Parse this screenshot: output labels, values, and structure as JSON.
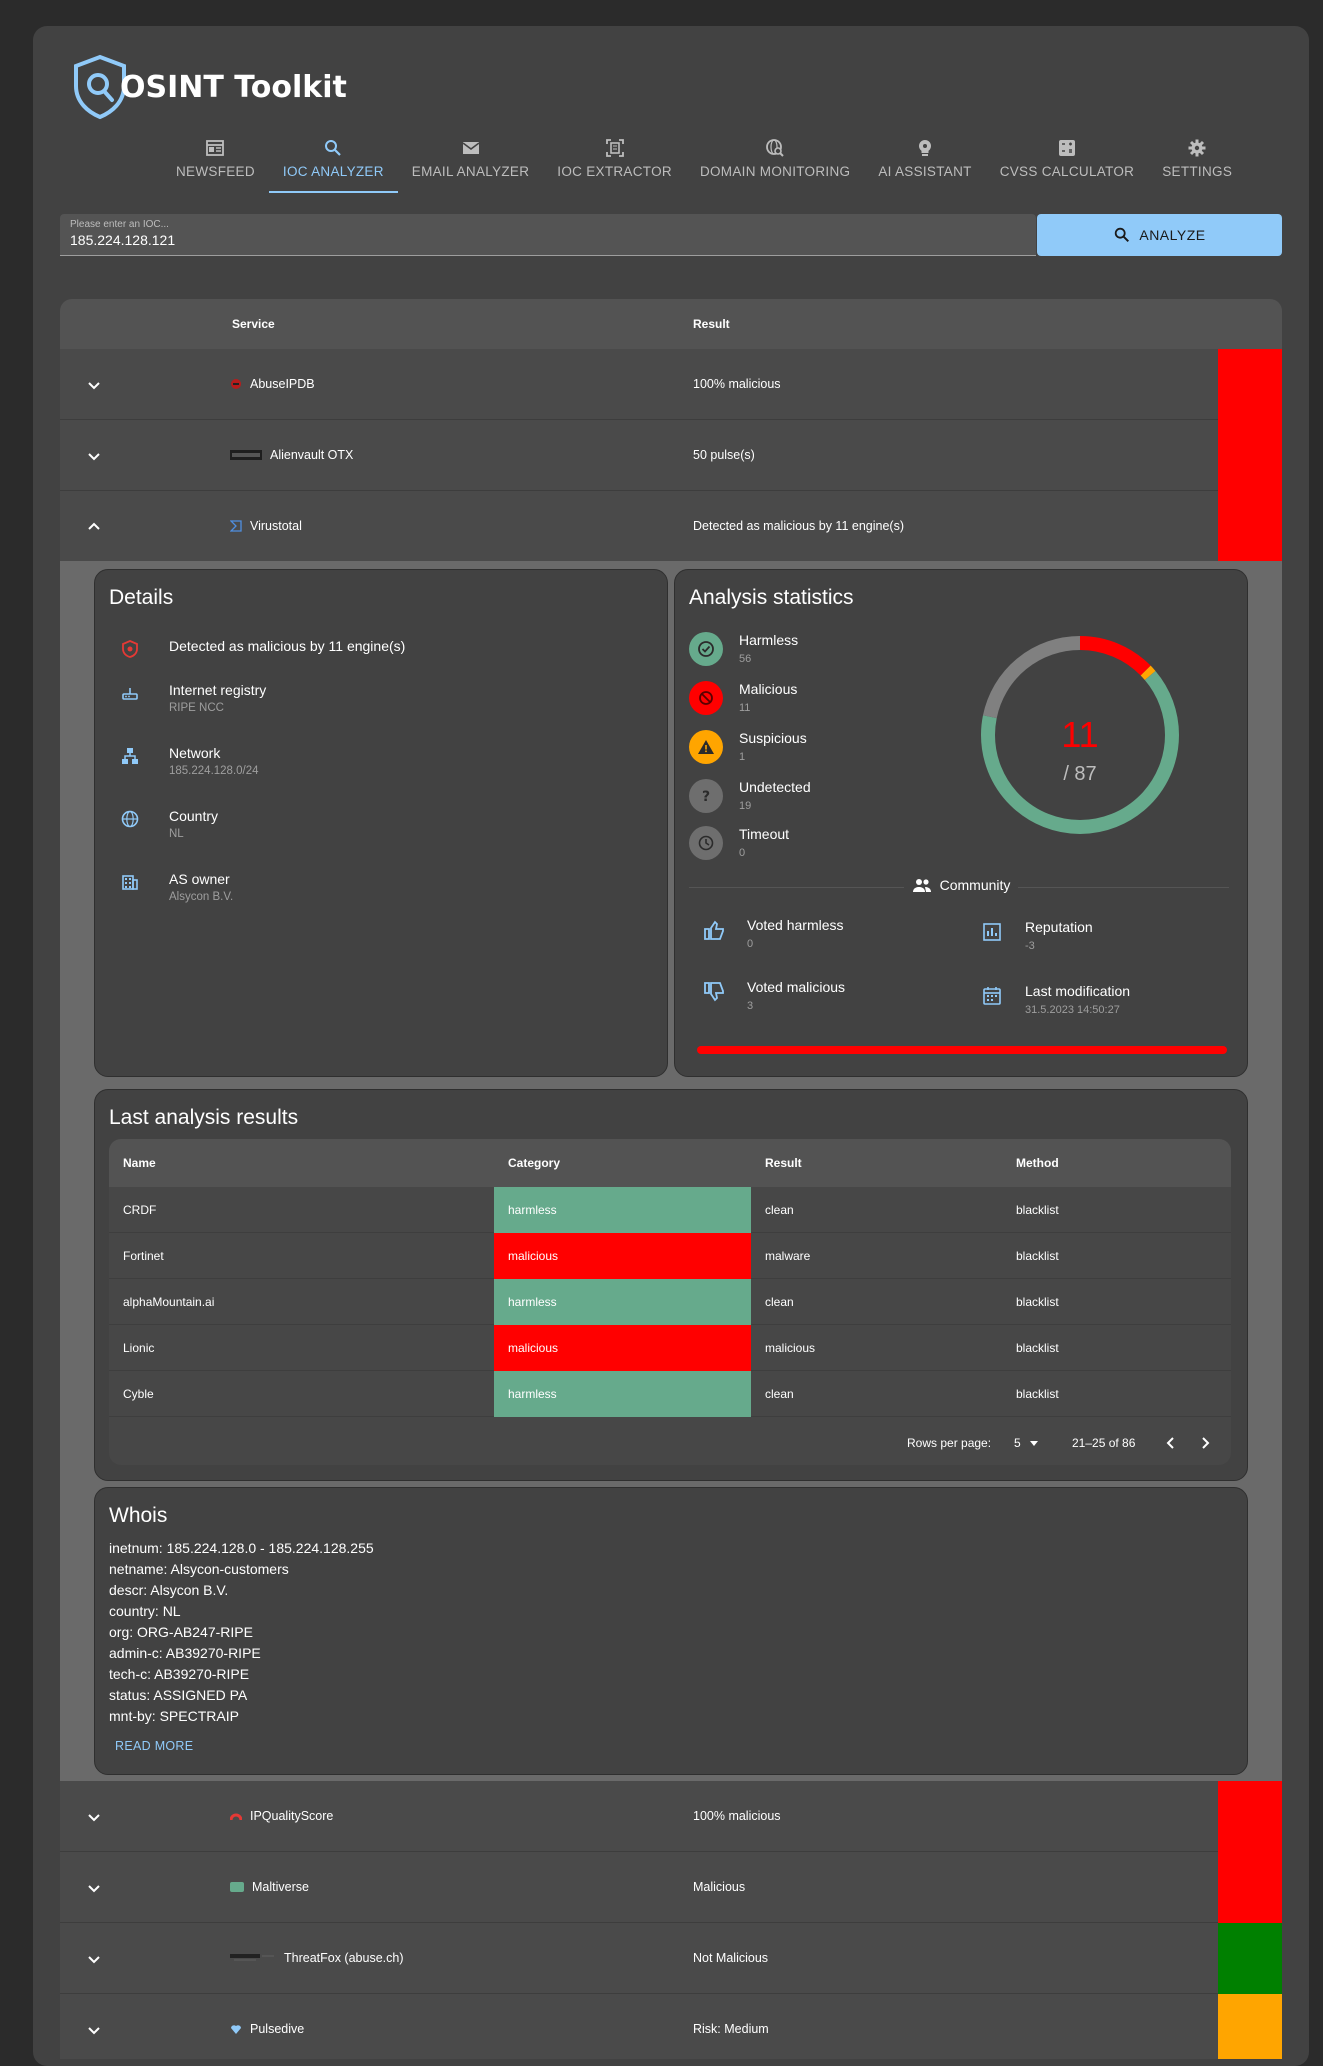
{
  "app": {
    "title": "OSINT Toolkit"
  },
  "nav": [
    {
      "label": "NEWSFEED",
      "icon": "newsfeed-icon"
    },
    {
      "label": "IOC ANALYZER",
      "icon": "search-icon",
      "active": true
    },
    {
      "label": "EMAIL ANALYZER",
      "icon": "email-icon"
    },
    {
      "label": "IOC EXTRACTOR",
      "icon": "extractor-icon"
    },
    {
      "label": "DOMAIN MONITORING",
      "icon": "domain-monitor-icon"
    },
    {
      "label": "AI ASSISTANT",
      "icon": "ai-assistant-icon"
    },
    {
      "label": "CVSS CALCULATOR",
      "icon": "calculator-icon"
    },
    {
      "label": "SETTINGS",
      "icon": "gear-icon"
    }
  ],
  "search": {
    "label": "Please enter an IOC...",
    "value": "185.224.128.121",
    "button": "ANALYZE"
  },
  "table": {
    "headers": {
      "service": "Service",
      "result": "Result"
    },
    "rows_top": [
      {
        "service": "AbuseIPDB",
        "result": "100% malicious",
        "flag": "#ff0000",
        "icon": "abuseipdb-icon"
      },
      {
        "service": "Alienvault OTX",
        "result": "50 pulse(s)",
        "flag": "#ff0000",
        "icon": "alienvault-icon"
      },
      {
        "service": "Virustotal",
        "result": "Detected as malicious by 11 engine(s)",
        "flag": "#ff0000",
        "icon": "virustotal-icon"
      }
    ],
    "rows_bottom": [
      {
        "service": "IPQualityScore",
        "result": "100% malicious",
        "flag": "#ff0000",
        "icon": "ipqualityscore-icon"
      },
      {
        "service": "Maltiverse",
        "result": "Malicious",
        "flag": "#ff0000",
        "icon": "maltiverse-icon"
      },
      {
        "service": "ThreatFox (abuse.ch)",
        "result": "Not Malicious",
        "flag": "#008000",
        "icon": "threatfox-icon"
      },
      {
        "service": "Pulsedive",
        "result": "Risk: Medium",
        "flag": "#ffa500",
        "icon": "pulsedive-icon"
      }
    ]
  },
  "details": {
    "title": "Details",
    "items": [
      {
        "main": "Detected as malicious by 11 engine(s)",
        "sub": "",
        "icon": "shield-alert-icon"
      },
      {
        "main": "Internet registry",
        "sub": "RIPE NCC",
        "icon": "router-icon"
      },
      {
        "main": "Network",
        "sub": "185.224.128.0/24",
        "icon": "network-icon"
      },
      {
        "main": "Country",
        "sub": "NL",
        "icon": "globe-icon"
      },
      {
        "main": "AS owner",
        "sub": "Alsycon B.V.",
        "icon": "building-icon"
      }
    ]
  },
  "stats": {
    "title": "Analysis statistics",
    "items": [
      {
        "label": "Harmless",
        "value": "56",
        "color": "#66aa8c",
        "icon": "check-circle-icon"
      },
      {
        "label": "Malicious",
        "value": "11",
        "color": "#ff0000",
        "icon": "malicious-icon"
      },
      {
        "label": "Suspicious",
        "value": "1",
        "color": "#ffa500",
        "icon": "warning-icon"
      },
      {
        "label": "Undetected",
        "value": "19",
        "color": "#6e6e6e",
        "icon": "question-icon"
      },
      {
        "label": "Timeout",
        "value": "0",
        "color": "#6e6e6e",
        "icon": "clock-icon"
      }
    ],
    "donut": {
      "malicious": 11,
      "suspicious": 1,
      "harmless": 56,
      "undetected": 19,
      "total": 87,
      "center_value": "11",
      "center_total": "/ 87"
    },
    "community": {
      "title": "Community",
      "voted_harmless": {
        "label": "Voted harmless",
        "value": "0"
      },
      "voted_malicious": {
        "label": "Voted malicious",
        "value": "3"
      },
      "reputation": {
        "label": "Reputation",
        "value": "-3"
      },
      "last_modification": {
        "label": "Last modification",
        "value": "31.5.2023 14:50:27"
      }
    },
    "reputation_bar_color": "#ff0000"
  },
  "last_analysis": {
    "title": "Last analysis results",
    "headers": {
      "name": "Name",
      "category": "Category",
      "result": "Result",
      "method": "Method"
    },
    "rows": [
      {
        "name": "CRDF",
        "category": "harmless",
        "result": "clean",
        "method": "blacklist",
        "color": "#66aa8c"
      },
      {
        "name": "Fortinet",
        "category": "malicious",
        "result": "malware",
        "method": "blacklist",
        "color": "#ff0000"
      },
      {
        "name": "alphaMountain.ai",
        "category": "harmless",
        "result": "clean",
        "method": "blacklist",
        "color": "#66aa8c"
      },
      {
        "name": "Lionic",
        "category": "malicious",
        "result": "malicious",
        "method": "blacklist",
        "color": "#ff0000"
      },
      {
        "name": "Cyble",
        "category": "harmless",
        "result": "clean",
        "method": "blacklist",
        "color": "#66aa8c"
      }
    ],
    "pagination": {
      "rows_label": "Rows per page:",
      "rows_value": "5",
      "range": "21–25 of 86"
    }
  },
  "whois": {
    "title": "Whois",
    "lines": [
      "inetnum: 185.224.128.0 - 185.224.128.255",
      "netname: Alsycon-customers",
      "descr: Alsycon B.V.",
      "country: NL",
      "org: ORG-AB247-RIPE",
      "admin-c: AB39270-RIPE",
      "tech-c: AB39270-RIPE",
      "status: ASSIGNED PA",
      "mnt-by: SPECTRAIP"
    ],
    "read_more": "READ MORE"
  }
}
